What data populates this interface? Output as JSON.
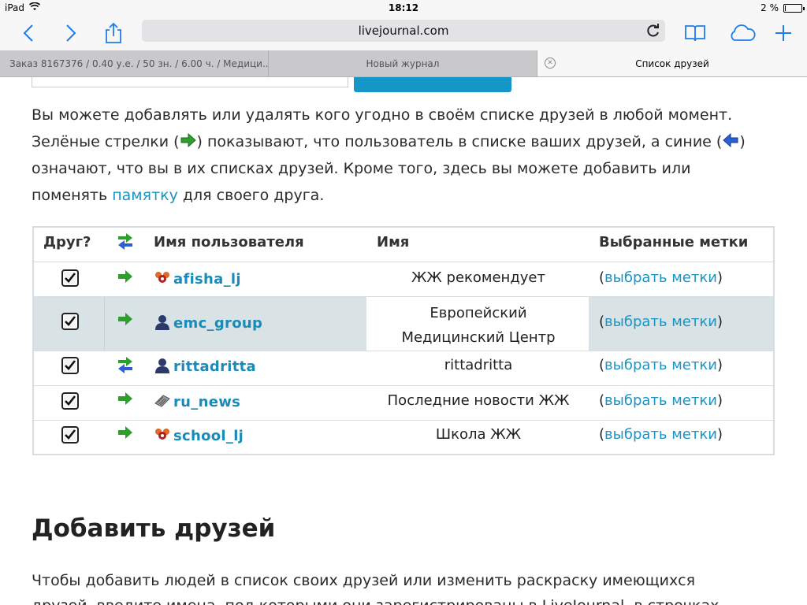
{
  "status_bar": {
    "device": "iPad",
    "time": "18:12",
    "battery": "2 %"
  },
  "browser": {
    "url": "livejournal.com",
    "tabs": [
      {
        "label": "Заказ 8167376 / 0.40 у.е. / 50 зн. / 6.00 ч. / Медици..."
      },
      {
        "label": "Новый журнал"
      },
      {
        "label": "Список друзей"
      }
    ]
  },
  "intro": {
    "p1": "Вы можете добавлять или удалять кого угодно в своём списке друзей в любой момент.",
    "p2a": "Зелёные стрелки (",
    "p2b": ") показывают, что пользователь в списке ваших друзей, а синие (",
    "p2c": ")",
    "p3": "означают, что вы в их списках друзей. Кроме того, здесь вы можете добавить или",
    "p4a": "поменять ",
    "p4_link": "памятку",
    "p4b": " для своего друга."
  },
  "table": {
    "headers": {
      "friend": "Друг?",
      "username": "Имя пользователя",
      "name": "Имя",
      "tags": "Выбранные метки"
    },
    "rows": [
      {
        "username": "afisha_lj",
        "name_line1": "ЖЖ рекомендует",
        "name_line2": "",
        "tags_open": "(",
        "tags_link": "выбрать метки",
        "tags_close": ")",
        "arrow": "green",
        "icon": "community-icon"
      },
      {
        "username": "emc_group",
        "name_line1": "Европейский",
        "name_line2": "Медицинский Центр",
        "tags_open": "(",
        "tags_link": "выбрать метки",
        "tags_close": ")",
        "arrow": "green",
        "icon": "user-icon"
      },
      {
        "username": "rittadritta",
        "name_line1": "rittadritta",
        "name_line2": "",
        "tags_open": "(",
        "tags_link": "выбрать метки",
        "tags_close": ")",
        "arrow": "both",
        "icon": "user-icon"
      },
      {
        "username": "ru_news",
        "name_line1": "Последние новости ЖЖ",
        "name_line2": "",
        "tags_open": "(",
        "tags_link": "выбрать метки",
        "tags_close": ")",
        "arrow": "green",
        "icon": "news-icon"
      },
      {
        "username": "school_lj",
        "name_line1": "Школа ЖЖ",
        "name_line2": "",
        "tags_open": "(",
        "tags_link": "выбрать метки",
        "tags_close": ")",
        "arrow": "green",
        "icon": "community-icon"
      }
    ]
  },
  "add_friends": {
    "title": "Добавить друзей",
    "line1": "Чтобы добавить людей в список своих друзей или изменить раскраску имеющихся",
    "line2": "друзей, введите имена, под которыми они зарегистрированы в LiveJournal, в строчках"
  },
  "colors": {
    "link": "#1a94c4",
    "accent_button": "#1596c6",
    "highlight_row": "#d9e2e5",
    "green_arrow": "#2e9e2e",
    "blue_arrow": "#2a5fd6"
  }
}
